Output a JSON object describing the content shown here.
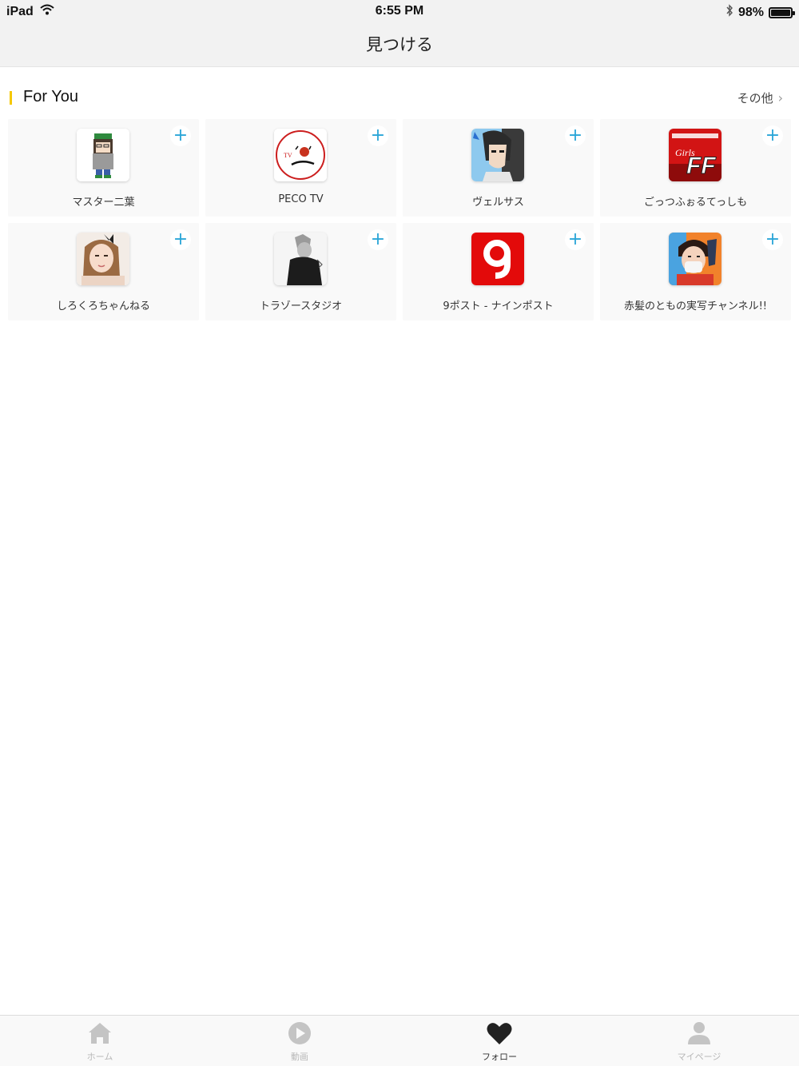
{
  "status_bar": {
    "device": "iPad",
    "time": "6:55 PM",
    "battery": "98%",
    "battery_level": 0.98
  },
  "nav": {
    "title": "見つける"
  },
  "section": {
    "title": "For You",
    "more_label": "その他",
    "accent_color": "#f6c800"
  },
  "channels": [
    {
      "name": "マスター二葉",
      "icon": "avatar-illustration"
    },
    {
      "name": "PECO TV",
      "icon": "peco-tv-logo"
    },
    {
      "name": "ヴェルサス",
      "icon": "anime-avatar"
    },
    {
      "name": "ごっつふぉるてっしも",
      "icon": "girls-ff-logo"
    },
    {
      "name": "しろくろちゃんねる",
      "icon": "photo-avatar"
    },
    {
      "name": "トラゾースタジオ",
      "icon": "monochrome-avatar"
    },
    {
      "name": "9ポスト - ナインポスト",
      "icon": "nine-post-logo"
    },
    {
      "name": "赤髪のともの実写チャンネル!!",
      "icon": "masked-avatar"
    }
  ],
  "add_button": {
    "symbol": "+",
    "color": "#2ba6d8"
  },
  "tab_bar": {
    "tabs": [
      {
        "label": "ホーム",
        "icon": "home-icon",
        "active": false
      },
      {
        "label": "動画",
        "icon": "play-icon",
        "active": false
      },
      {
        "label": "フォロー",
        "icon": "heart-icon",
        "active": true
      },
      {
        "label": "マイページ",
        "icon": "person-icon",
        "active": false
      }
    ],
    "inactive_color": "#c4c4c4",
    "active_color": "#222222"
  }
}
